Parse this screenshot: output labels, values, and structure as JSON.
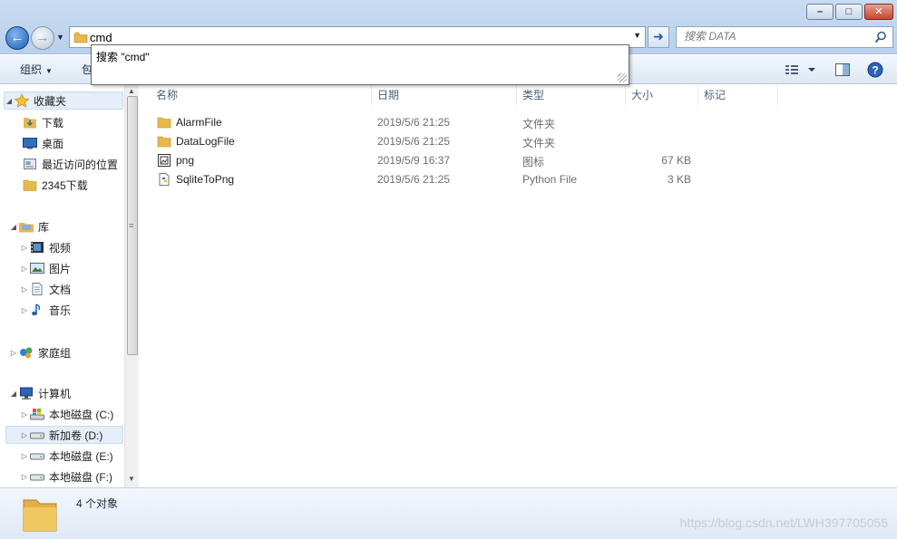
{
  "address": {
    "value": "cmd"
  },
  "search": {
    "placeholder": "搜索 DATA"
  },
  "suggest": {
    "item": "搜索 \"cmd\""
  },
  "toolbar": {
    "organize_label": "组织",
    "include_label": "包"
  },
  "nav": {
    "favorites": {
      "label": "收藏夹",
      "items": [
        "下载",
        "桌面",
        "最近访问的位置",
        "2345下载"
      ]
    },
    "libraries": {
      "label": "库",
      "items": [
        "视频",
        "图片",
        "文档",
        "音乐"
      ]
    },
    "homegroup": {
      "label": "家庭组"
    },
    "computer": {
      "label": "计算机",
      "items": [
        "本地磁盘 (C:)",
        "新加卷 (D:)",
        "本地磁盘 (E:)",
        "本地磁盘 (F:)"
      ]
    }
  },
  "columns": [
    "名称",
    "日期",
    "类型",
    "大小",
    "标记"
  ],
  "files": [
    {
      "name": "AlarmFile",
      "date": "2019/5/6 21:25",
      "type": "文件夹",
      "size": "",
      "icon": "folder-icon"
    },
    {
      "name": "DataLogFile",
      "date": "2019/5/6 21:25",
      "type": "文件夹",
      "size": "",
      "icon": "folder-icon"
    },
    {
      "name": "png",
      "date": "2019/5/9 16:37",
      "type": "图标",
      "size": "67 KB",
      "icon": "image-file-icon"
    },
    {
      "name": "SqliteToPng",
      "date": "2019/5/6 21:25",
      "type": "Python File",
      "size": "3 KB",
      "icon": "python-file-icon"
    }
  ],
  "status": {
    "count": "4 个对象"
  },
  "watermark": "https://blog.csdn.net/LWH397705055",
  "colors": {
    "accent": "#1f5fb3",
    "folder": "#e8b84a",
    "selection": "#e5eef9"
  }
}
